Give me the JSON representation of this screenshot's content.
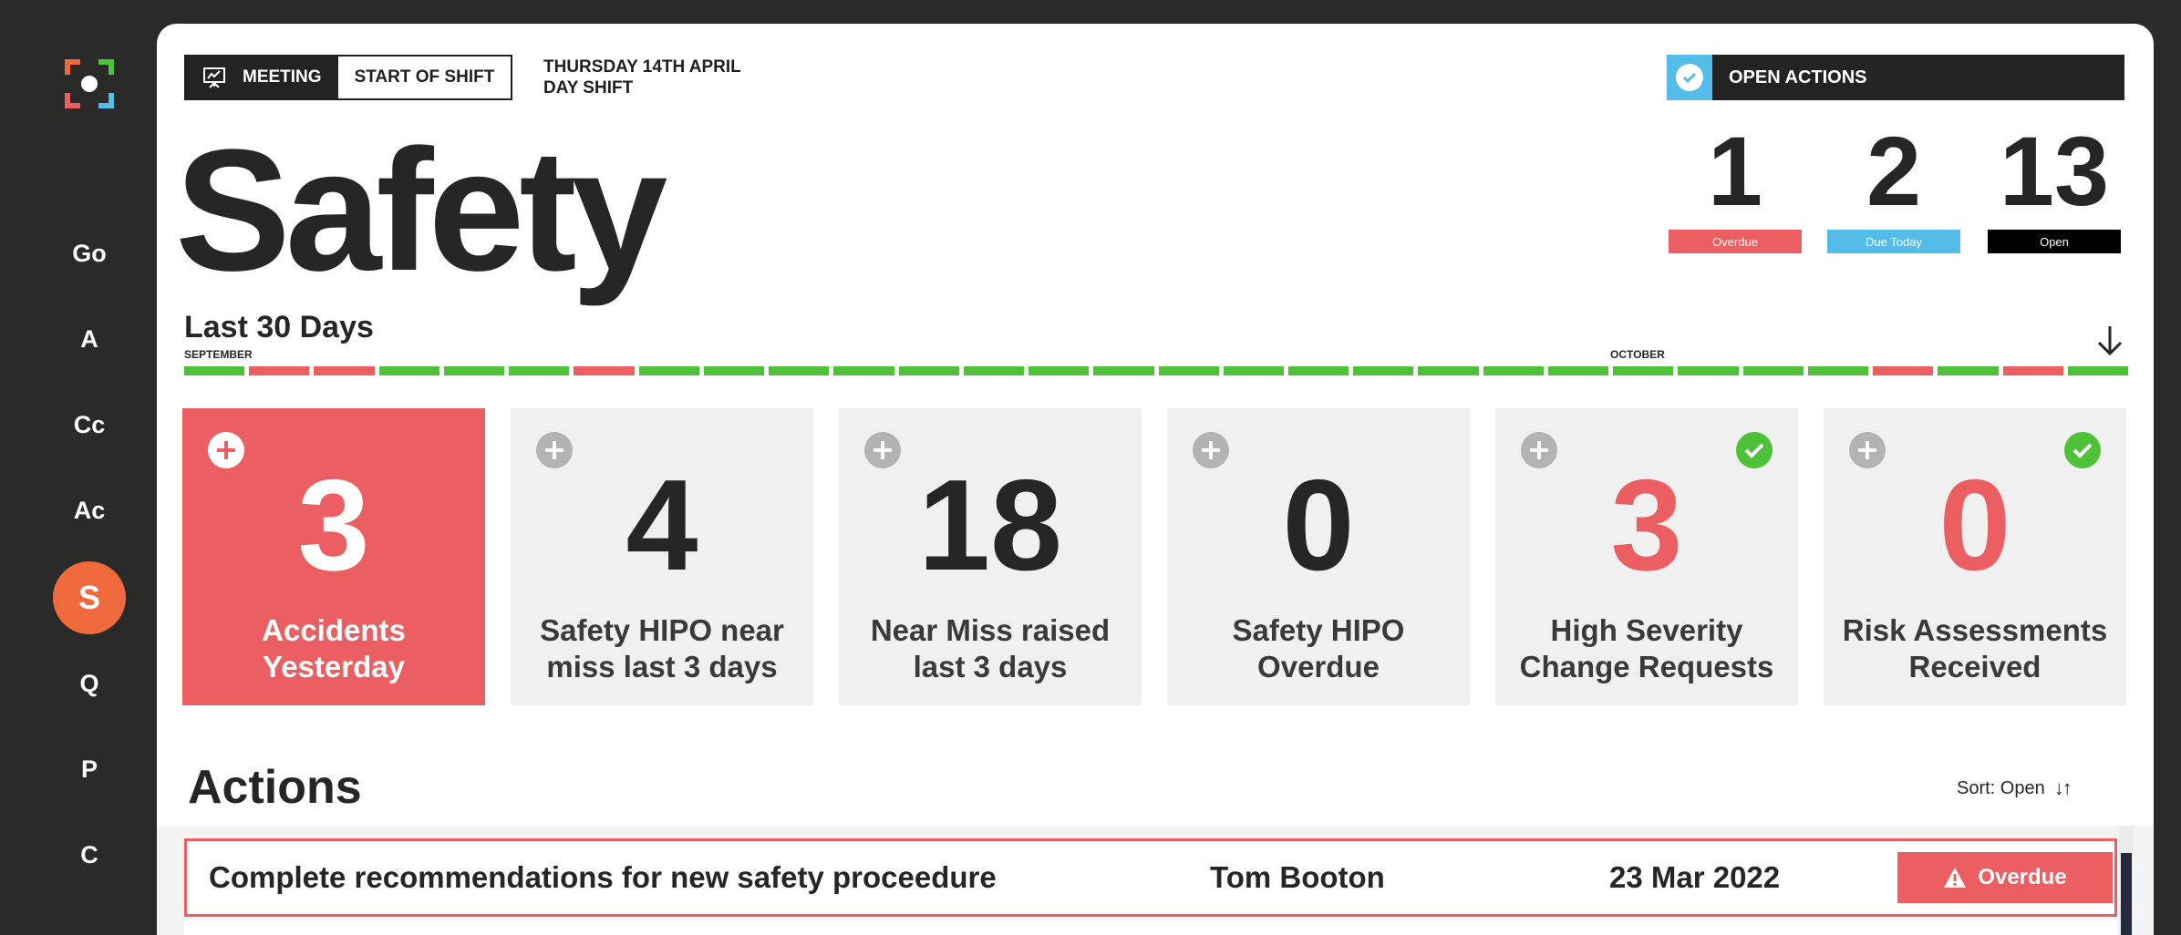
{
  "sidebar": {
    "items": [
      {
        "label": "Go"
      },
      {
        "label": "A"
      },
      {
        "label": "Cc"
      },
      {
        "label": "Ac"
      },
      {
        "label": "S",
        "active": true
      },
      {
        "label": "Q"
      },
      {
        "label": "P"
      },
      {
        "label": "C"
      }
    ]
  },
  "header": {
    "mode_meeting": "MEETING",
    "mode_start_of_shift": "START OF SHIFT",
    "date_line1": "THURSDAY 14TH APRIL",
    "date_line2": "DAY  SHIFT",
    "page_title": "Safety"
  },
  "open_actions": {
    "label": "OPEN ACTIONS",
    "stats": [
      {
        "value": "1",
        "label": "Overdue",
        "color": "#eb5e61"
      },
      {
        "value": "2",
        "label": "Due Today",
        "color": "#55bce9"
      },
      {
        "value": "13",
        "label": "Open",
        "color": "#000000"
      }
    ]
  },
  "timeline": {
    "title": "Last 30 Days",
    "months": [
      "SEPTEMBER",
      "OCTOBER"
    ],
    "days": [
      "ok",
      "bad",
      "bad",
      "ok",
      "ok",
      "ok",
      "bad",
      "ok",
      "ok",
      "ok",
      "ok",
      "ok",
      "ok",
      "ok",
      "ok",
      "ok",
      "ok",
      "ok",
      "ok",
      "ok",
      "ok",
      "ok",
      "ok",
      "ok",
      "ok",
      "ok",
      "bad",
      "ok",
      "bad",
      "ok"
    ],
    "colors": {
      "ok": "#4fc139",
      "bad": "#eb5e61"
    }
  },
  "cards": [
    {
      "value": "3",
      "label": "Accidents Yesterday",
      "style": "red",
      "check": false
    },
    {
      "value": "4",
      "label": "Safety HIPO near miss last 3 days",
      "style": "grey",
      "check": false
    },
    {
      "value": "18",
      "label": "Near Miss raised last 3 days",
      "style": "grey",
      "check": false
    },
    {
      "value": "0",
      "label": "Safety HIPO Overdue",
      "style": "grey",
      "check": false
    },
    {
      "value": "3",
      "label": "High Severity Change Requests",
      "style": "grey-redtext",
      "check": true
    },
    {
      "value": "0",
      "label": "Risk Assessments Received",
      "style": "grey-redtext",
      "check": true
    }
  ],
  "actions": {
    "title": "Actions",
    "sort_label": "Sort: Open",
    "sort_arrows": "↓↑",
    "rows": [
      {
        "task": "Complete recommendations for new safety proceedure",
        "person": "Tom Booton",
        "date": "23 Mar 2022",
        "status": "Overdue"
      }
    ]
  }
}
